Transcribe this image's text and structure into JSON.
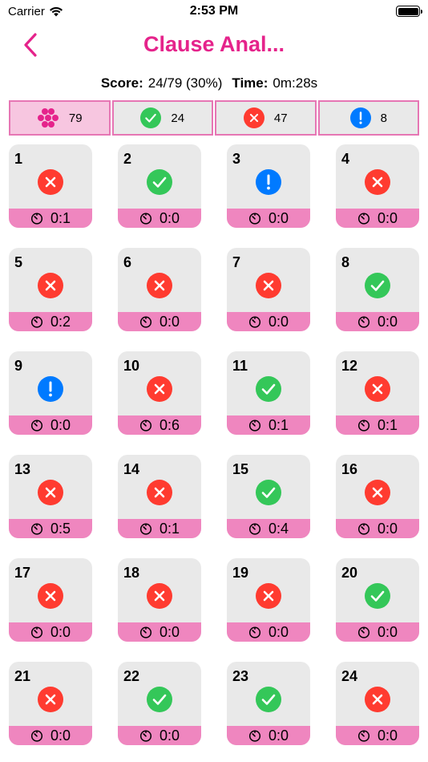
{
  "status_bar": {
    "carrier": "Carrier",
    "time": "2:53 PM"
  },
  "nav": {
    "title": "Clause Anal..."
  },
  "score": {
    "score_label": "Score:",
    "score_value": "24/79 (30%)",
    "time_label": "Time:",
    "time_value": "0m:28s"
  },
  "filters": [
    {
      "icon": "cluster-icon",
      "count": "79"
    },
    {
      "icon": "check-icon",
      "count": "24"
    },
    {
      "icon": "cross-icon",
      "count": "47"
    },
    {
      "icon": "exclamation-icon",
      "count": "8"
    }
  ],
  "colors": {
    "accent": "#e5238b",
    "correct": "#34c759",
    "wrong": "#ff3b30",
    "skipped": "#007aff",
    "tile_footer": "#ef86bf"
  },
  "questions": [
    {
      "num": "1",
      "status": "wrong",
      "time": "0:1"
    },
    {
      "num": "2",
      "status": "correct",
      "time": "0:0"
    },
    {
      "num": "3",
      "status": "skipped",
      "time": "0:0"
    },
    {
      "num": "4",
      "status": "wrong",
      "time": "0:0"
    },
    {
      "num": "5",
      "status": "wrong",
      "time": "0:2"
    },
    {
      "num": "6",
      "status": "wrong",
      "time": "0:0"
    },
    {
      "num": "7",
      "status": "wrong",
      "time": "0:0"
    },
    {
      "num": "8",
      "status": "correct",
      "time": "0:0"
    },
    {
      "num": "9",
      "status": "skipped",
      "time": "0:0"
    },
    {
      "num": "10",
      "status": "wrong",
      "time": "0:6"
    },
    {
      "num": "11",
      "status": "correct",
      "time": "0:1"
    },
    {
      "num": "12",
      "status": "wrong",
      "time": "0:1"
    },
    {
      "num": "13",
      "status": "wrong",
      "time": "0:5"
    },
    {
      "num": "14",
      "status": "wrong",
      "time": "0:1"
    },
    {
      "num": "15",
      "status": "correct",
      "time": "0:4"
    },
    {
      "num": "16",
      "status": "wrong",
      "time": "0:0"
    },
    {
      "num": "17",
      "status": "wrong",
      "time": "0:0"
    },
    {
      "num": "18",
      "status": "wrong",
      "time": "0:0"
    },
    {
      "num": "19",
      "status": "wrong",
      "time": "0:0"
    },
    {
      "num": "20",
      "status": "correct",
      "time": "0:0"
    },
    {
      "num": "21",
      "status": "wrong",
      "time": "0:0"
    },
    {
      "num": "22",
      "status": "correct",
      "time": "0:0"
    },
    {
      "num": "23",
      "status": "correct",
      "time": "0:0"
    },
    {
      "num": "24",
      "status": "wrong",
      "time": "0:0"
    }
  ]
}
